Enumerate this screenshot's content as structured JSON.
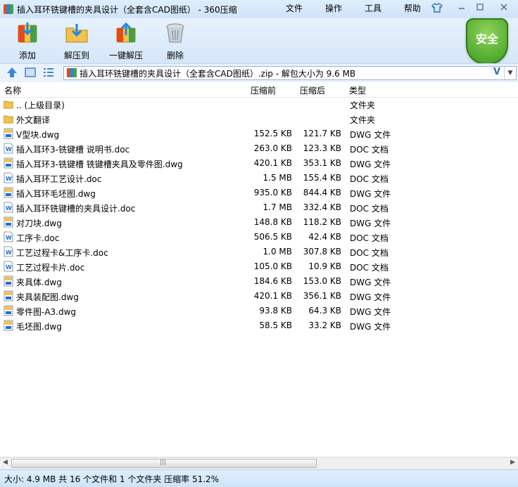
{
  "window": {
    "title": "插入耳环铣键槽的夹具设计（全套含CAD图纸） - 360压缩",
    "menu": [
      "文件",
      "操作",
      "工具",
      "帮助"
    ]
  },
  "toolbar": {
    "add_label": "添加",
    "extract_label": "解压到",
    "oneclick_label": "一键解压",
    "delete_label": "删除",
    "safe_label": "安全"
  },
  "address": {
    "path": "插入耳环铣键槽的夹具设计（全套含CAD图纸）.zip - 解包大小为 9.6 MB",
    "v_mark": "V"
  },
  "columns": {
    "name": "名称",
    "size": "压缩前",
    "packed": "压缩后",
    "type": "类型"
  },
  "files": [
    {
      "icon": "folder-icon",
      "name": ".. (上级目录)",
      "size": "",
      "packed": "",
      "type": "文件夹"
    },
    {
      "icon": "folder-icon",
      "name": "外文翻译",
      "size": "",
      "packed": "",
      "type": "文件夹"
    },
    {
      "icon": "dwg-file-icon",
      "name": "V型块.dwg",
      "size": "152.5 KB",
      "packed": "121.7 KB",
      "type": "DWG 文件"
    },
    {
      "icon": "doc-file-icon",
      "name": "插入耳环3-铣键槽 说明书.doc",
      "size": "263.0 KB",
      "packed": "123.3 KB",
      "type": "DOC 文档"
    },
    {
      "icon": "dwg-file-icon",
      "name": "插入耳环3-铣键槽 铣键槽夹具及零件图.dwg",
      "size": "420.1 KB",
      "packed": "353.1 KB",
      "type": "DWG 文件"
    },
    {
      "icon": "doc-file-icon",
      "name": "插入耳环工艺设计.doc",
      "size": "1.5 MB",
      "packed": "155.4 KB",
      "type": "DOC 文档"
    },
    {
      "icon": "dwg-file-icon",
      "name": "插入耳环毛坯图.dwg",
      "size": "935.0 KB",
      "packed": "844.4 KB",
      "type": "DWG 文件"
    },
    {
      "icon": "doc-file-icon",
      "name": "插入耳环铣键槽的夹具设计.doc",
      "size": "1.7 MB",
      "packed": "332.4 KB",
      "type": "DOC 文档"
    },
    {
      "icon": "dwg-file-icon",
      "name": "对刀块.dwg",
      "size": "148.8 KB",
      "packed": "118.2 KB",
      "type": "DWG 文件"
    },
    {
      "icon": "doc-file-icon",
      "name": "工序卡.doc",
      "size": "506.5 KB",
      "packed": "42.4 KB",
      "type": "DOC 文档"
    },
    {
      "icon": "doc-file-icon",
      "name": "工艺过程卡&工序卡.doc",
      "size": "1.0 MB",
      "packed": "307.8 KB",
      "type": "DOC 文档"
    },
    {
      "icon": "doc-file-icon",
      "name": "工艺过程卡片.doc",
      "size": "105.0 KB",
      "packed": "10.9 KB",
      "type": "DOC 文档"
    },
    {
      "icon": "dwg-file-icon",
      "name": "夹具体.dwg",
      "size": "184.6 KB",
      "packed": "153.0 KB",
      "type": "DWG 文件"
    },
    {
      "icon": "dwg-file-icon",
      "name": "夹具装配图.dwg",
      "size": "420.1 KB",
      "packed": "356.1 KB",
      "type": "DWG 文件"
    },
    {
      "icon": "dwg-file-icon",
      "name": "零件图-A3.dwg",
      "size": "93.8 KB",
      "packed": "64.3 KB",
      "type": "DWG 文件"
    },
    {
      "icon": "dwg-file-icon",
      "name": "毛坯图.dwg",
      "size": "58.5 KB",
      "packed": "33.2 KB",
      "type": "DWG 文件"
    }
  ],
  "status": "大小: 4.9 MB 共 16 个文件和 1 个文件夹 压缩率 51.2%",
  "colors": {
    "accent": "#2d6fb8",
    "titlebar": "#dfeefc",
    "safe_green": "#3c9b1f",
    "folder": "#f2c14e"
  }
}
